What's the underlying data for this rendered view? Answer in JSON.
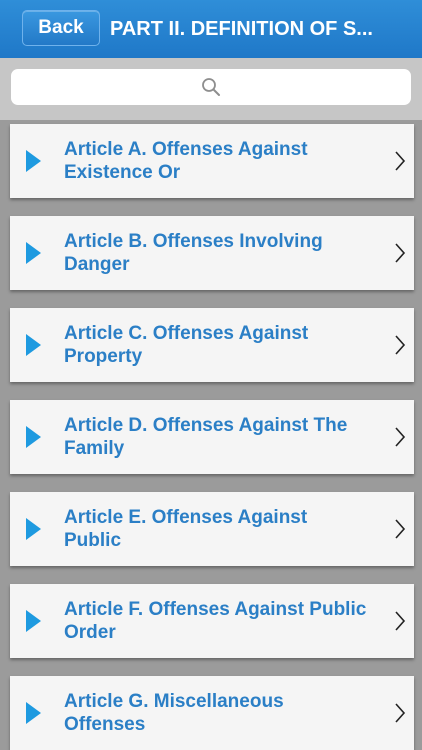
{
  "navbar": {
    "back_label": "Back",
    "title": "PART II.  DEFINITION OF S..."
  },
  "search": {
    "placeholder": ""
  },
  "items": [
    {
      "label": "Article A.  Offenses Against\nExistence Or"
    },
    {
      "label": "Article B.  Offenses Involving\nDanger"
    },
    {
      "label": "Article C.  Offenses Against\nProperty"
    },
    {
      "label": "Article D.  Offenses Against The\nFamily"
    },
    {
      "label": "Article E.  Offenses Against\nPublic"
    },
    {
      "label": "Article F.  Offenses Against Public\nOrder"
    },
    {
      "label": "Article G.  Miscellaneous\nOffenses"
    }
  ],
  "colors": {
    "accent": "#1f78c8",
    "item_text": "#2b7fc6",
    "play_icon": "#1e9ae0"
  }
}
